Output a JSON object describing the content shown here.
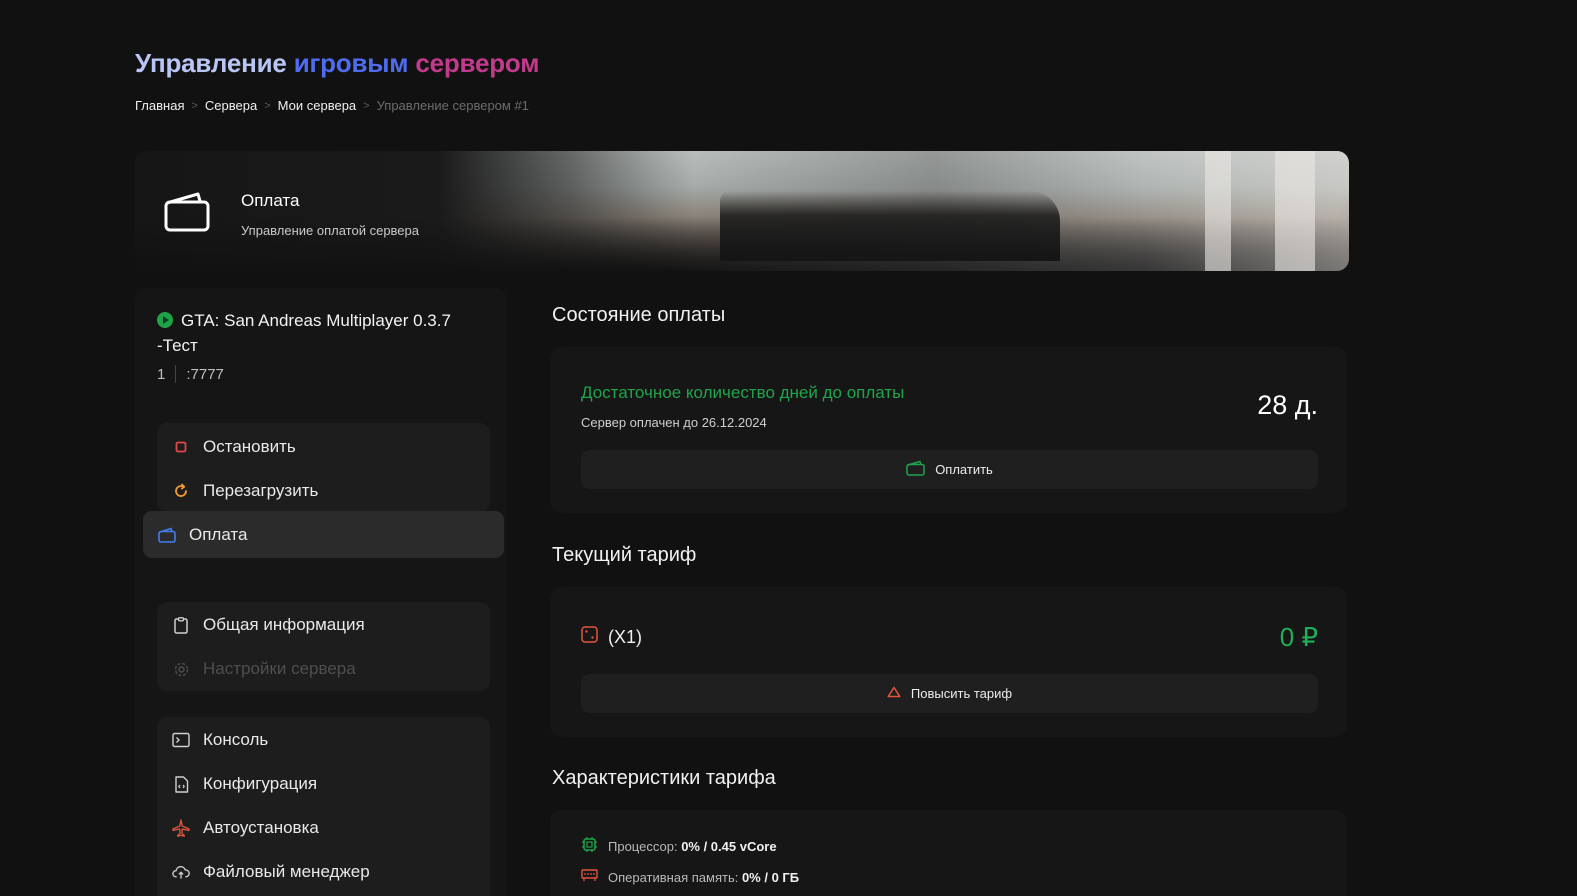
{
  "header": {
    "title_part1": "Управление",
    "title_part2": "игровым",
    "title_part3": "сервером",
    "title_colors": [
      "#b9c6f5",
      "#4f6cf0",
      "#c23a8c"
    ]
  },
  "breadcrumb": {
    "items": [
      "Главная",
      "Сервера",
      "Мои сервера",
      "Управление сервером #1"
    ],
    "separator": ">"
  },
  "banner": {
    "title": "Оплата",
    "subtitle": "Управление оплатой сервера",
    "icon": "wallet-icon"
  },
  "server": {
    "name": "GTA: San Andreas Multiplayer 0.3.7 -Тест",
    "status_color": "#1fa34a",
    "id": "1",
    "port": ":7777"
  },
  "sidebar": {
    "controls": [
      {
        "label": "Остановить",
        "icon": "stop-icon",
        "color": "#e0474c"
      },
      {
        "label": "Перезагрузить",
        "icon": "restart-icon",
        "color": "#f29a2e"
      },
      {
        "label": "Оплата",
        "icon": "wallet-icon",
        "color": "#3f7ef0",
        "active": true
      }
    ],
    "info": [
      {
        "label": "Общая информация",
        "icon": "clipboard-icon"
      },
      {
        "label": "Настройки сервера",
        "icon": "gear-icon",
        "disabled": true
      }
    ],
    "tools": [
      {
        "label": "Консоль",
        "icon": "terminal-icon"
      },
      {
        "label": "Конфигурация",
        "icon": "config-file-icon"
      },
      {
        "label": "Автоустановка",
        "icon": "airplane-icon",
        "color": "#e2563f"
      },
      {
        "label": "Файловый менеджер",
        "icon": "cloud-upload-icon"
      }
    ]
  },
  "payment_status": {
    "section_title": "Состояние оплаты",
    "status_text": "Достаточное количество дней до оплаты",
    "paid_until": "Сервер оплачен до 26.12.2024",
    "days_left": "28 д.",
    "pay_button": "Оплатить",
    "accent": "#1fa44c"
  },
  "current_tariff": {
    "section_title": "Текущий тариф",
    "name": "(X1)",
    "price": "0 ₽",
    "upgrade_button": "Повысить тариф"
  },
  "tariff_specs": {
    "section_title": "Характеристики тарифа",
    "items": [
      {
        "label": "Процессор:",
        "value": "0% / 0.45 vCore",
        "icon": "cpu-icon"
      },
      {
        "label": "Оперативная память:",
        "value": "0% / 0 ГБ",
        "icon": "ram-icon"
      }
    ]
  }
}
